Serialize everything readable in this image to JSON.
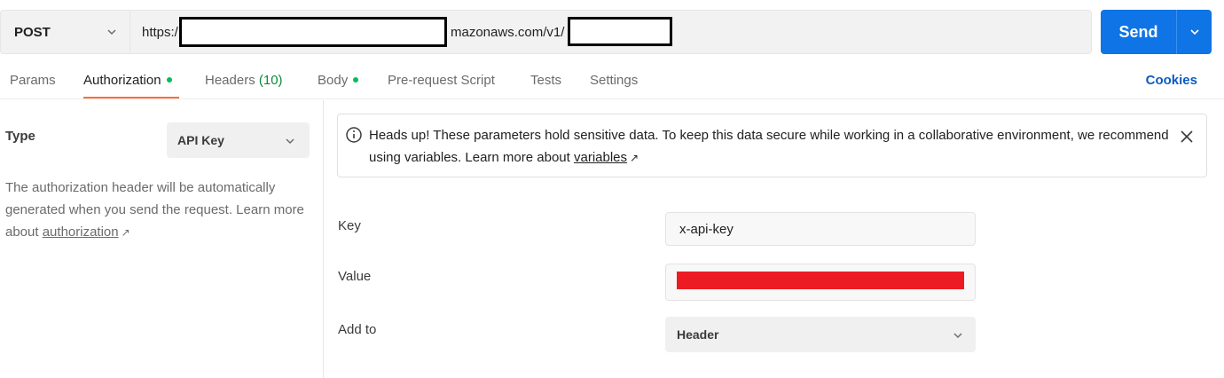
{
  "request": {
    "method": "POST",
    "url_prefix": "https:/",
    "url_middle": "mazonaws.com/v1/",
    "send_label": "Send"
  },
  "tabs": [
    {
      "label": "Params"
    },
    {
      "label": "Authorization",
      "dot": true
    },
    {
      "label": "Headers",
      "count": "(10)"
    },
    {
      "label": "Body",
      "dot": true
    },
    {
      "label": "Pre-request Script"
    },
    {
      "label": "Tests"
    },
    {
      "label": "Settings"
    }
  ],
  "cookies_label": "Cookies",
  "auth": {
    "type_label": "Type",
    "type_value": "API Key",
    "description": "The authorization header will be automatically generated when you send the request. Learn more about",
    "description_link": "authorization",
    "arrow": "↗"
  },
  "notice": {
    "text": "Heads up! These parameters hold sensitive data. To keep this data secure while working in a collaborative environment, we recommend using variables. Learn more about",
    "link": "variables",
    "arrow": "↗"
  },
  "fields": {
    "key_label": "Key",
    "key_value": "x-api-key",
    "value_label": "Value",
    "add_to_label": "Add to",
    "add_to_value": "Header"
  },
  "colors": {
    "send_button": "#0f74e5",
    "active_tab_underline": "#ff6c37",
    "status_dot": "#0cbb52",
    "redaction_red": "#ed1c24"
  }
}
